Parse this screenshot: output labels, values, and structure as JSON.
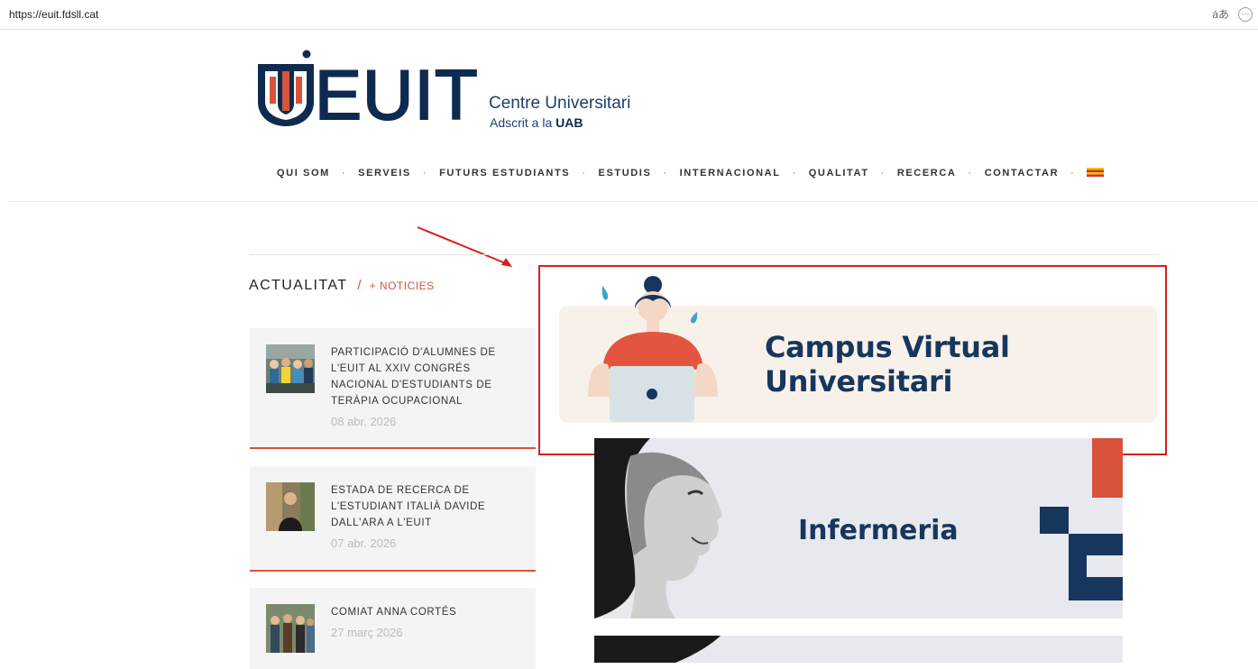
{
  "browser": {
    "url": "https://euit.fdsll.cat",
    "translate_icon": "translate-icon",
    "translate_glyph": "áあ",
    "more_icon": "more-icon",
    "more_glyph": "⋯"
  },
  "logo": {
    "word": "EUIT",
    "subtitle_line1": "Centre Universitari",
    "subtitle_line2_prefix": "Adscrit a la ",
    "subtitle_line2_bold": "UAB",
    "colors": {
      "navy": "#0e2b4f",
      "red": "#d9533b"
    }
  },
  "nav": {
    "items": [
      "QUI SOM",
      "SERVEIS",
      "FUTURS ESTUDIANTS",
      "ESTUDIS",
      "INTERNACIONAL",
      "QUALITAT",
      "RECERCA",
      "CONTACTAR"
    ],
    "separator": "·",
    "language_icon": "spain-flag-icon"
  },
  "news": {
    "heading": "ACTUALITAT",
    "slash": "/",
    "more_link": "+ NOTICIES",
    "items": [
      {
        "title": "PARTICIPACIÓ D'ALUMNES DE L'EUIT AL XXIV CONGRÉS NACIONAL D'ESTUDIANTS DE TERÀPIA OCUPACIONAL",
        "date": "08 abr. 2026"
      },
      {
        "title": "ESTADA DE RECERCA DE L'ESTUDIANT ITALIÀ DAVIDE DALL'ARA A L'EUIT",
        "date": "07 abr. 2026"
      },
      {
        "title": "COMIAT ANNA CORTÉS",
        "date": "27 març 2026"
      }
    ]
  },
  "banners": {
    "campus_line1": "Campus Virtual",
    "campus_line2": "Universitari",
    "infermeria": "Infermeria"
  }
}
